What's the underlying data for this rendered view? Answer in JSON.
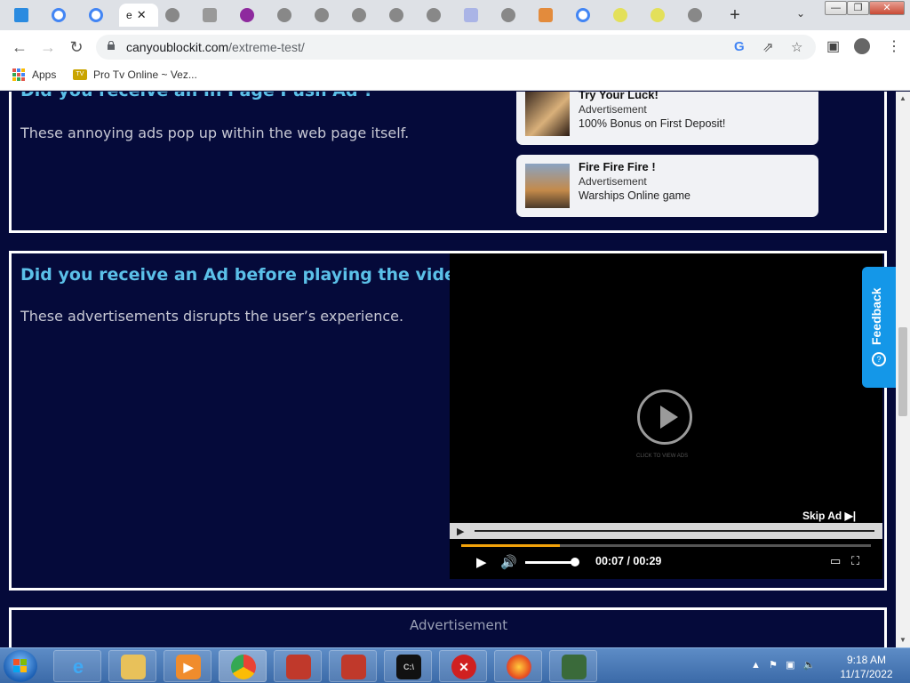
{
  "browser": {
    "active_tab": {
      "title": "e",
      "close": "✕"
    },
    "new_tab": "+",
    "tab_search": "⌄",
    "window_controls": [
      "—",
      "❐",
      "✕"
    ],
    "url_host": "canyoublockit.com",
    "url_path": "/extreme-test/",
    "bookmarks": [
      {
        "label": "Apps",
        "icon": "apps-grid-icon"
      },
      {
        "label": "Pro Tv Online ~ Vez...",
        "icon": "tv-icon"
      }
    ]
  },
  "page": {
    "section1": {
      "heading": "Did you receive an In Page Push Ad ?",
      "description": "These annoying ads pop up within the web page itself."
    },
    "ads": [
      {
        "title": "Try Your Luck!",
        "sub": "Advertisement",
        "text": "100% Bonus on First Deposit!"
      },
      {
        "title": "Fire Fire Fire !",
        "sub": "Advertisement",
        "text": "Warships Online game"
      }
    ],
    "section2": {
      "heading": "Did you receive an Ad before playing the video ?",
      "description": "These advertisements disrupts the user’s experience."
    },
    "video": {
      "click_text": "CLICK TO VIEW ADS",
      "skip_label": "Skip Ad",
      "time": "00:07 / 00:29",
      "progress": 0.24,
      "volume": 1.0
    },
    "section3": {
      "label": "Advertisement"
    },
    "feedback_label": "Feedback"
  },
  "taskbar": {
    "clock_time": "9:18 AM",
    "clock_date": "11/17/2022"
  },
  "colors": {
    "page_bg": "#050a3a",
    "heading": "#5bc0e8",
    "feedback": "#1497e8",
    "progress": "#f2a20a"
  }
}
